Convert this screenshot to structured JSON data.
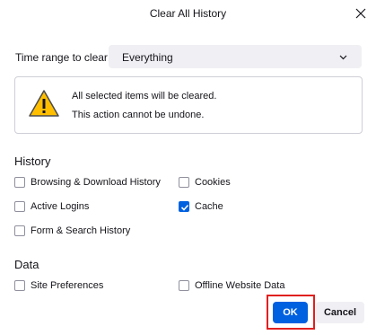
{
  "window": {
    "title": "Clear All History"
  },
  "time_range": {
    "label": "Time range to clear:",
    "selected": "Everything"
  },
  "warning": {
    "line1": "All selected items will be cleared.",
    "line2": "This action cannot be undone."
  },
  "history": {
    "heading": "History",
    "items": [
      {
        "label": "Browsing & Download History",
        "checked": false
      },
      {
        "label": "Cookies",
        "checked": false
      },
      {
        "label": "Active Logins",
        "checked": false
      },
      {
        "label": "Cache",
        "checked": true
      },
      {
        "label": "Form & Search History",
        "checked": false
      }
    ]
  },
  "data": {
    "heading": "Data",
    "items": [
      {
        "label": "Site Preferences",
        "checked": false
      },
      {
        "label": "Offline Website Data",
        "checked": false
      }
    ]
  },
  "buttons": {
    "ok": "OK",
    "cancel": "Cancel"
  },
  "colors": {
    "accent": "#0061e0",
    "highlight": "#e0201f",
    "warning": "#ffbf00"
  }
}
